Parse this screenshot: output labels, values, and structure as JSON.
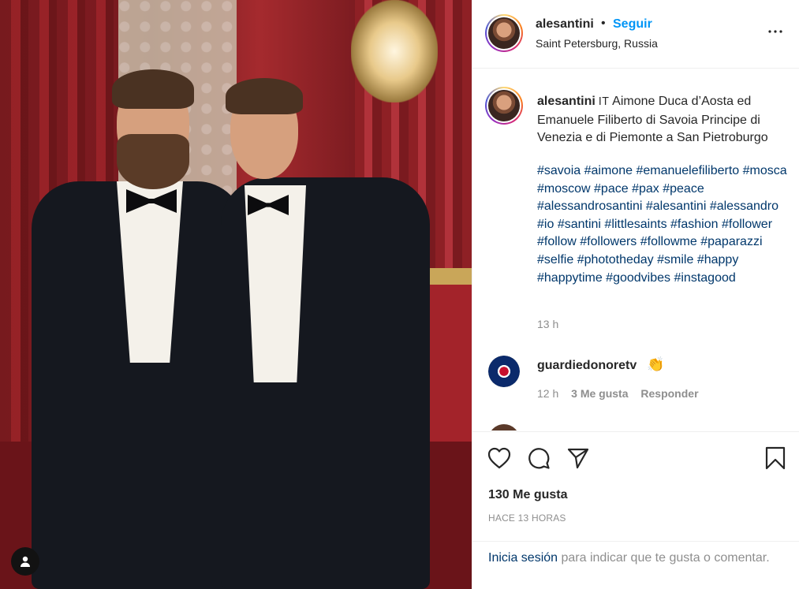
{
  "post": {
    "username": "alesantini",
    "dot": "•",
    "follow_label": "Seguir",
    "location": "Saint Petersburg, Russia",
    "more_icon": "more-horizontal-icon"
  },
  "caption": {
    "username": "alesantini",
    "flag": "IT",
    "text": "Aimone Duca d’Aosta ed Emanuele Filiberto di Savoia Principe di Venezia e di Piemonte a San Pietroburgo",
    "hashtags": [
      "#savoia",
      "#aimone",
      "#emanuelefiliberto",
      "#mosca",
      "#moscow",
      "#pace",
      "#pax",
      "#peace",
      "#alessandrosantini",
      "#alesantini",
      "#alessandro",
      "#io",
      "#santini",
      "#littlesaints",
      "#fashion",
      "#follower",
      "#follow",
      "#followers",
      "#followme",
      "#paparazzi",
      "#selfie",
      "#phototheday",
      "#smile",
      "#happy",
      "#happytime",
      "#goodvibes",
      "#instagood"
    ],
    "time": "13 h"
  },
  "comments": [
    {
      "username": "guardiedonoretv",
      "emoji": "👏",
      "time": "12 h",
      "likes": "3 Me gusta",
      "reply": "Responder"
    }
  ],
  "actions": {
    "like_icon": "heart-icon",
    "comment_icon": "comment-icon",
    "share_icon": "send-icon",
    "save_icon": "bookmark-icon"
  },
  "likes_text": "130 Me gusta",
  "posted_ago": "HACE 13 HORAS",
  "login_prompt": {
    "link": "Inicia sesión",
    "text": " para indicar que te gusta o comentar."
  },
  "colors": {
    "accent": "#0095f6",
    "hashtag": "#00376b",
    "muted": "#8e8e8e",
    "text": "#262626"
  }
}
